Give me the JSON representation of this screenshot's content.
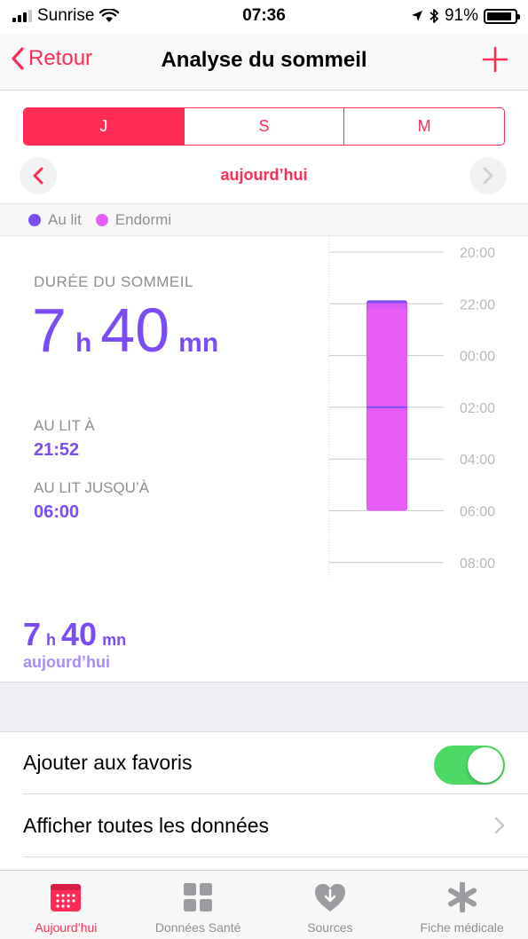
{
  "status_bar": {
    "carrier": "Sunrise",
    "time": "07:36",
    "battery": "91%",
    "battery_level": 0.91
  },
  "nav": {
    "back_label": "Retour",
    "title": "Analyse du sommeil"
  },
  "segments": [
    {
      "label": "J",
      "active": true
    },
    {
      "label": "S",
      "active": false
    },
    {
      "label": "M",
      "active": false
    }
  ],
  "date_nav": {
    "label": "aujourd’hui"
  },
  "legend": [
    {
      "label": "Au lit",
      "color": "#7b4cf5"
    },
    {
      "label": "Endormi",
      "color": "#e65cf4"
    }
  ],
  "summary": {
    "title": "DURÉE DU SOMMEIL",
    "hours": "7",
    "hours_unit": "h",
    "minutes": "40",
    "minutes_unit": "mn",
    "in_bed_label": "AU LIT À",
    "in_bed_value": "21:52",
    "in_bed_until_label": "AU LIT JUSQU’À",
    "in_bed_until_value": "06:00"
  },
  "chart_data": {
    "type": "bar",
    "y_ticks": [
      "20:00",
      "22:00",
      "00:00",
      "02:00",
      "04:00",
      "06:00",
      "08:00"
    ],
    "series": [
      {
        "name": "Au lit",
        "start": "21:52",
        "end": "06:00",
        "color": "#7b4cf5"
      },
      {
        "name": "Endormi",
        "start": "22:10",
        "end": "06:00",
        "color": "#e65cf4"
      }
    ]
  },
  "total": {
    "hours": "7",
    "hours_unit": "h",
    "minutes": "40",
    "minutes_unit": "mn",
    "label": "aujourd’hui"
  },
  "actions": {
    "favorites_label": "Ajouter aux favoris",
    "favorites_on": true,
    "show_all_label": "Afficher toutes les données"
  },
  "tabs": [
    {
      "label": "Aujourd’hui",
      "icon": "calendar-icon",
      "active": true
    },
    {
      "label": "Données Santé",
      "icon": "grid-icon",
      "active": false
    },
    {
      "label": "Sources",
      "icon": "heart-download-icon",
      "active": false
    },
    {
      "label": "Fiche médicale",
      "icon": "asterisk-icon",
      "active": false
    }
  ],
  "colors": {
    "accent": "#ff2d55",
    "in_bed": "#7b4cf5",
    "asleep": "#e65cf4",
    "toggle_on": "#4cd964"
  }
}
